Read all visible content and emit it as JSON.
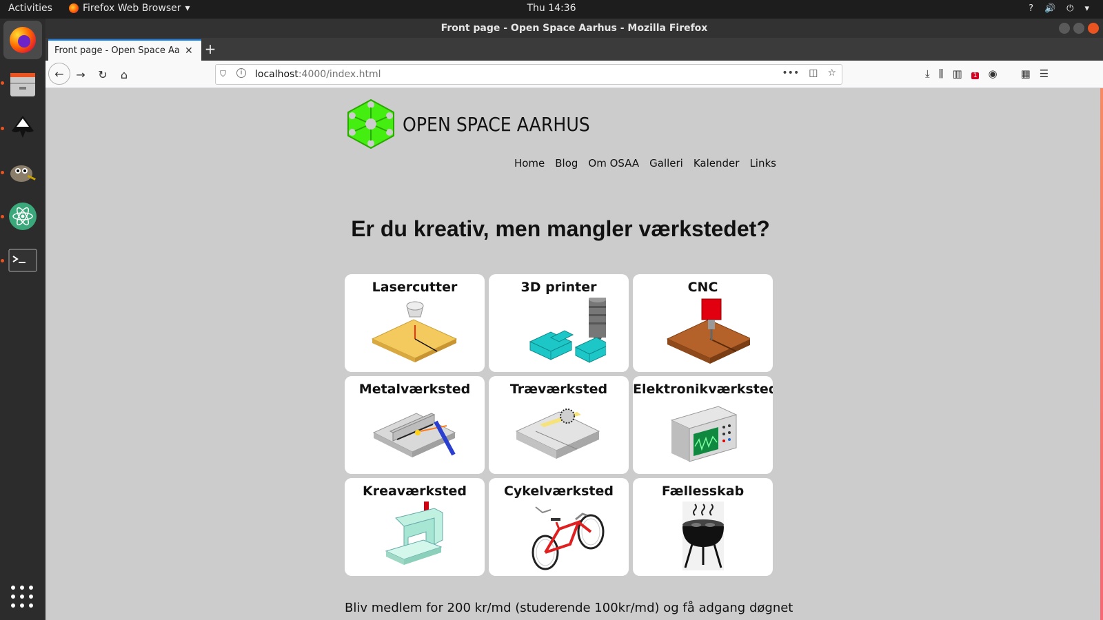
{
  "topbar": {
    "activities": "Activities",
    "app_name": "Firefox Web Browser",
    "clock": "Thu 14:36",
    "tray": [
      "?",
      "🔊",
      "⏻",
      "▾"
    ]
  },
  "window": {
    "title": "Front page - Open Space Aarhus - Mozilla Firefox"
  },
  "tabs": [
    {
      "label": "Front page - Open Space Aarhus"
    }
  ],
  "urlbar": {
    "host": "localhost",
    "rest": ":4000/index.html"
  },
  "toolbar": {
    "badge_count": "1"
  },
  "site": {
    "name": "OPEN SPACE AARHUS",
    "nav": [
      "Home",
      "Blog",
      "Om OSAA",
      "Galleri",
      "Kalender",
      "Links"
    ],
    "headline": "Er du kreativ, men mangler værkstedet?",
    "cards": [
      {
        "title": "Lasercutter",
        "icon": "lasercutter-icon"
      },
      {
        "title": "3D printer",
        "icon": "3d-printer-icon"
      },
      {
        "title": "CNC",
        "icon": "cnc-icon"
      },
      {
        "title": "Metalværksted",
        "icon": "metal-workshop-icon"
      },
      {
        "title": "Træværksted",
        "icon": "wood-workshop-icon"
      },
      {
        "title": "Elektronikværksted",
        "icon": "electronics-workshop-icon"
      },
      {
        "title": "Kreaværksted",
        "icon": "sewing-machine-icon"
      },
      {
        "title": "Cykelværksted",
        "icon": "bicycle-icon"
      },
      {
        "title": "Fællesskab",
        "icon": "barbecue-grill-icon"
      }
    ],
    "bottom_text": "Bliv medlem for 200 kr/md (studerende 100kr/md) og få adgang døgnet"
  },
  "colors": {
    "page_bg": "#cccccc",
    "logo_green": "#44ee11",
    "ubuntu_orange": "#e95420"
  }
}
